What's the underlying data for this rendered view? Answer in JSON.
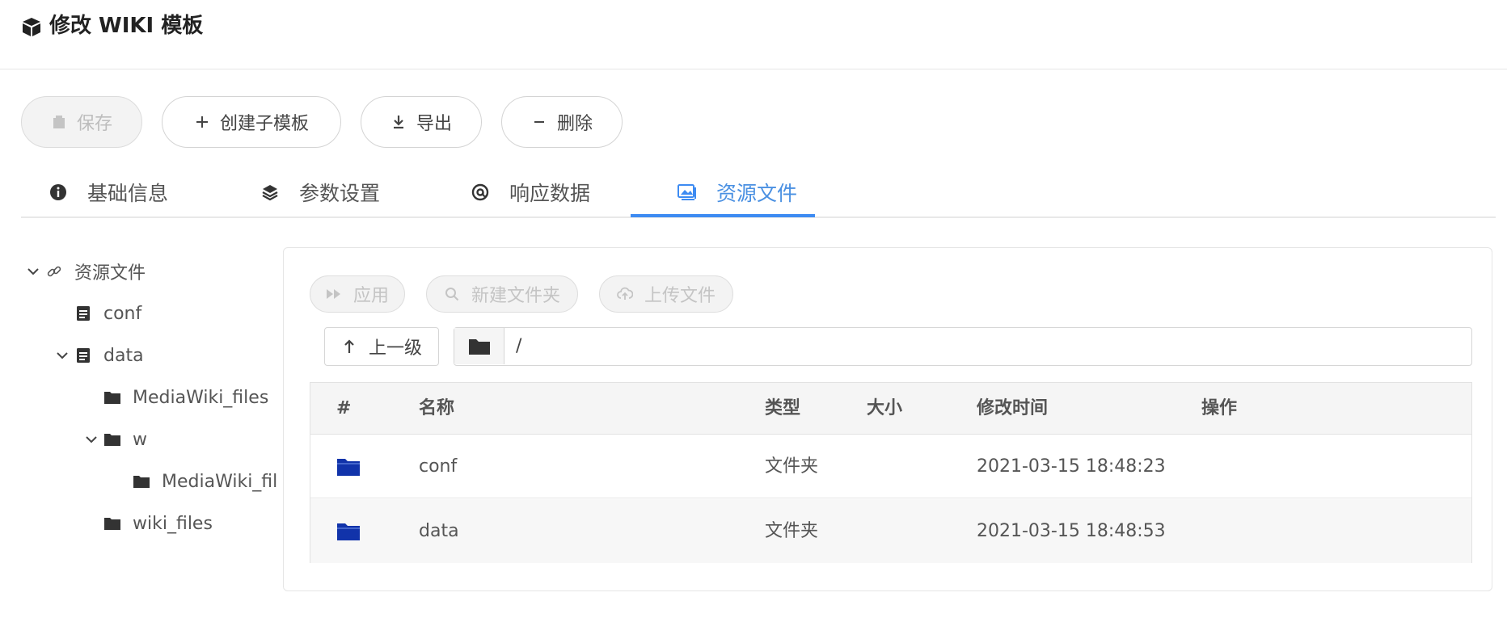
{
  "header": {
    "title": "修改 WIKI 模板",
    "icon": "cube-icon"
  },
  "toolbar": {
    "save_label": "保存",
    "create_child_label": "创建子模板",
    "export_label": "导出",
    "delete_label": "删除"
  },
  "tabs": [
    {
      "label": "基础信息",
      "icon": "info-icon"
    },
    {
      "label": "参数设置",
      "icon": "layers-icon"
    },
    {
      "label": "响应数据",
      "icon": "at-icon"
    },
    {
      "label": "资源文件",
      "icon": "image-icon",
      "active": true
    }
  ],
  "tree": {
    "root": "资源文件",
    "items": [
      "conf",
      "data",
      "MediaWiki_files",
      "w",
      "MediaWiki_fil",
      "wiki_files"
    ]
  },
  "panel": {
    "apply_label": "应用",
    "new_folder_label": "新建文件夹",
    "upload_label": "上传文件",
    "up_label": "上一级",
    "path": "/"
  },
  "table": {
    "headers": [
      "#",
      "名称",
      "类型",
      "大小",
      "修改时间",
      "操作"
    ],
    "rows": [
      {
        "name": "conf",
        "type": "文件夹",
        "size": "",
        "mtime": "2021-03-15 18:48:23",
        "actions": ""
      },
      {
        "name": "data",
        "type": "文件夹",
        "size": "",
        "mtime": "2021-03-15 18:48:53",
        "actions": ""
      }
    ]
  },
  "colors": {
    "accent": "#3d8bf2",
    "folder": "#1133aa",
    "icon_dark": "#555555"
  }
}
